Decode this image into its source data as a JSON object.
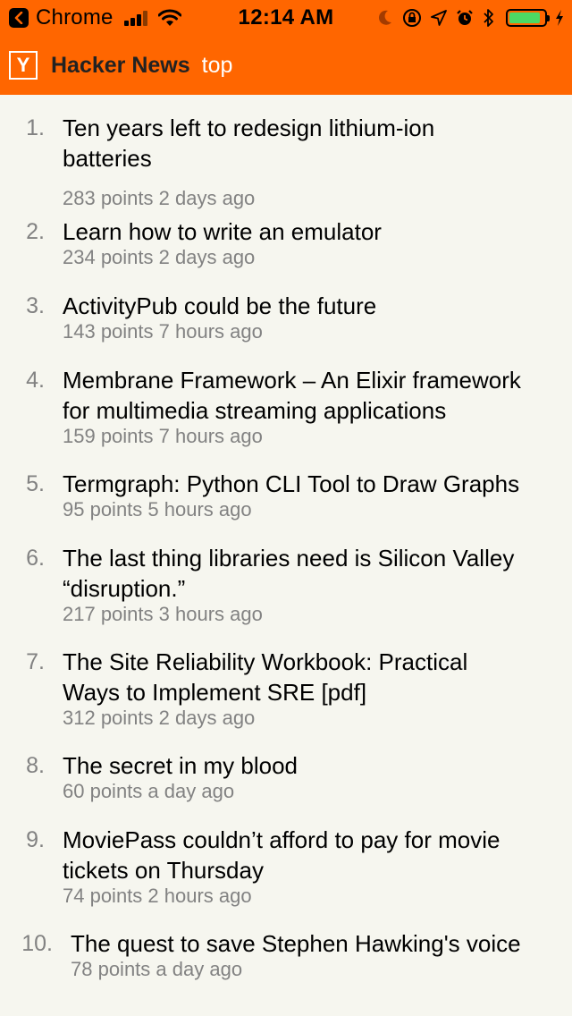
{
  "status_bar": {
    "back_app": "Chrome",
    "time": "12:14 AM",
    "battery_level": 0.9,
    "battery_color": "#4cd964",
    "icons": [
      "back-arrow-icon",
      "signal-icon",
      "wifi-icon",
      "moon-icon",
      "rotation-lock-icon",
      "location-icon",
      "alarm-icon",
      "bluetooth-icon",
      "battery-icon",
      "charging-bolt-icon"
    ]
  },
  "header": {
    "logo": "Y",
    "title": "Hacker News",
    "section": "top",
    "color": "#ff6600"
  },
  "stories": [
    {
      "rank": "1.",
      "title_lines": [
        "Ten years left to redesign lithium-ion",
        "batteries"
      ],
      "points": "283 points",
      "age": "2 days ago"
    },
    {
      "rank": "2.",
      "title_lines": [
        "Learn how to write an emulator"
      ],
      "points": "234 points",
      "age": "2 days ago"
    },
    {
      "rank": "3.",
      "title_lines": [
        "ActivityPub could be the future"
      ],
      "points": "143 points",
      "age": "7 hours ago"
    },
    {
      "rank": "4.",
      "title_lines": [
        "Membrane Framework – An Elixir framework",
        "for multimedia streaming applications"
      ],
      "points": "159 points",
      "age": "7 hours ago"
    },
    {
      "rank": "5.",
      "title_lines": [
        "Termgraph: Python CLI Tool to Draw Graphs"
      ],
      "points": "95 points",
      "age": "5 hours ago"
    },
    {
      "rank": "6.",
      "title_lines": [
        "The last thing libraries need is Silicon Valley",
        "“disruption.”"
      ],
      "points": "217 points",
      "age": "3 hours ago"
    },
    {
      "rank": "7.",
      "title_lines": [
        "The Site Reliability Workbook: Practical",
        "Ways to Implement SRE [pdf]"
      ],
      "points": "312 points",
      "age": "2 days ago"
    },
    {
      "rank": "8.",
      "title_lines": [
        "The secret in my blood"
      ],
      "points": "60 points",
      "age": "a day ago"
    },
    {
      "rank": "9.",
      "title_lines": [
        "MoviePass couldn’t afford to pay for movie",
        "tickets on Thursday"
      ],
      "points": "74 points",
      "age": "2 hours ago"
    },
    {
      "rank": "10.",
      "title_lines": [
        "The quest to save Stephen Hawking's voice"
      ],
      "points": "78 points",
      "age": "a day ago"
    }
  ]
}
